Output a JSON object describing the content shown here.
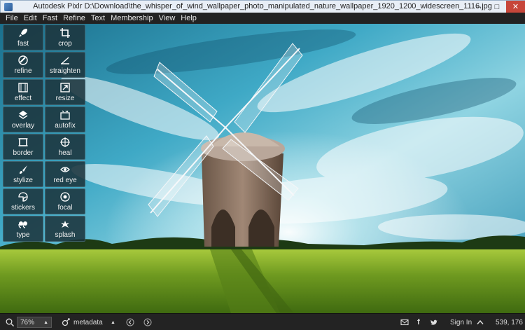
{
  "window": {
    "title": "Autodesk Pixlr   D:\\Download\\the_whisper_of_wind_wallpaper_photo_manipulated_nature_wallpaper_1920_1200_widescreen_1116.jpg",
    "minimize": "–",
    "maximize": "□",
    "close": "✕"
  },
  "menu": [
    "File",
    "Edit",
    "Fast",
    "Refine",
    "Text",
    "Membership",
    "View",
    "Help"
  ],
  "tools": [
    {
      "label": "fast",
      "icon": "rocket-icon"
    },
    {
      "label": "crop",
      "icon": "crop-icon"
    },
    {
      "label": "refine",
      "icon": "refine-icon"
    },
    {
      "label": "straighten",
      "icon": "straighten-icon"
    },
    {
      "label": "effect",
      "icon": "film-icon"
    },
    {
      "label": "resize",
      "icon": "resize-icon"
    },
    {
      "label": "overlay",
      "icon": "layers-icon"
    },
    {
      "label": "autofix",
      "icon": "autofix-icon"
    },
    {
      "label": "border",
      "icon": "border-icon"
    },
    {
      "label": "heal",
      "icon": "crosshair-icon"
    },
    {
      "label": "stylize",
      "icon": "brush-icon"
    },
    {
      "label": "red eye",
      "icon": "eye-icon"
    },
    {
      "label": "stickers",
      "icon": "sticker-icon"
    },
    {
      "label": "focal",
      "icon": "focal-icon"
    },
    {
      "label": "type",
      "icon": "quote-icon"
    },
    {
      "label": "splash",
      "icon": "splash-icon"
    }
  ],
  "status": {
    "zoom": "76%",
    "metadata": "metadata",
    "sign_in": "Sign In",
    "coordinates": "539, 176"
  },
  "colors": {
    "toolbar_bg": "#1c343c",
    "statusbar_bg": "#232323",
    "close_button": "#c7463a"
  }
}
